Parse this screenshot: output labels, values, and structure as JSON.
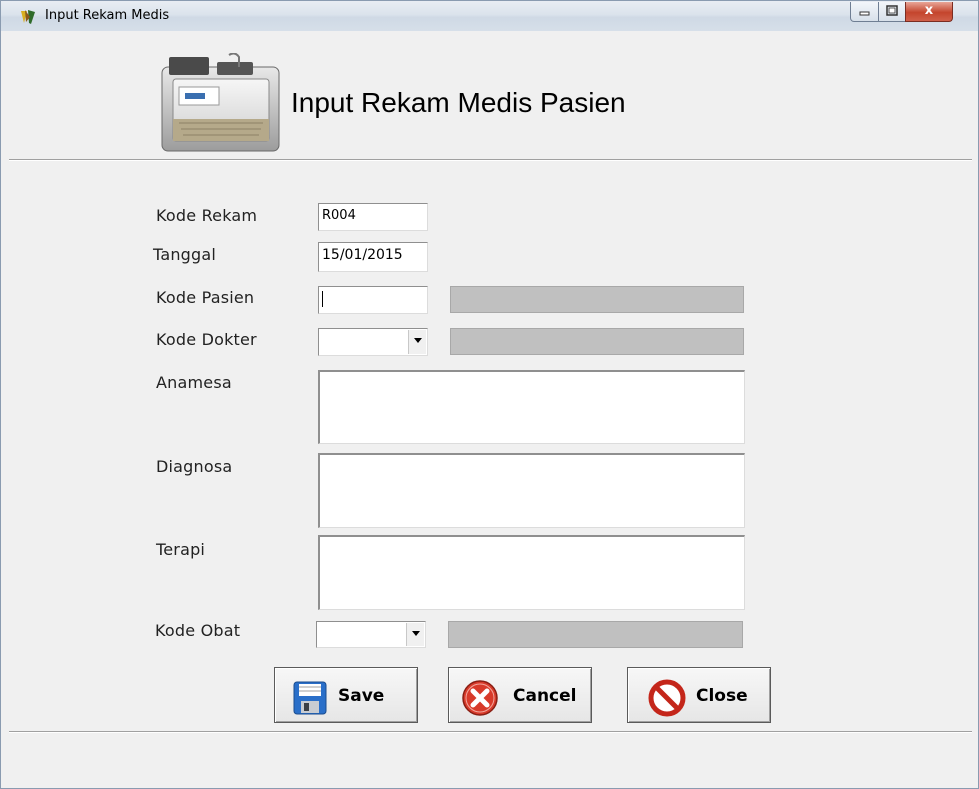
{
  "window": {
    "title": "Input Rekam Medis"
  },
  "titlebar_buttons": {
    "minimize": "minimize-icon",
    "maximize": "maximize-icon",
    "close": "close-icon",
    "close_glyph": "x"
  },
  "header": {
    "title": "Input Rekam Medis Pasien",
    "icon": "medical-record-folder-icon"
  },
  "form": {
    "kode_rekam": {
      "label": "Kode Rekam",
      "value": "R004"
    },
    "tanggal": {
      "label": "Tanggal",
      "value": "15/01/2015"
    },
    "kode_pasien": {
      "label": "Kode Pasien",
      "value": "",
      "name_value": ""
    },
    "kode_dokter": {
      "label": "Kode Dokter",
      "value": "",
      "name_value": ""
    },
    "anamesa": {
      "label": "Anamesa",
      "value": ""
    },
    "diagnosa": {
      "label": "Diagnosa",
      "value": ""
    },
    "terapi": {
      "label": "Terapi",
      "value": ""
    },
    "kode_obat": {
      "label": "Kode Obat",
      "value": "",
      "name_value": ""
    }
  },
  "buttons": {
    "save": {
      "label": "Save",
      "icon": "floppy-disk-icon"
    },
    "cancel": {
      "label": "Cancel",
      "icon": "cancel-x-icon"
    },
    "close": {
      "label": "Close",
      "icon": "no-entry-icon"
    }
  },
  "colors": {
    "readonly_field": "#c0c0c0",
    "cancel_red": "#d83a2a",
    "save_blue": "#2a6fc9"
  }
}
